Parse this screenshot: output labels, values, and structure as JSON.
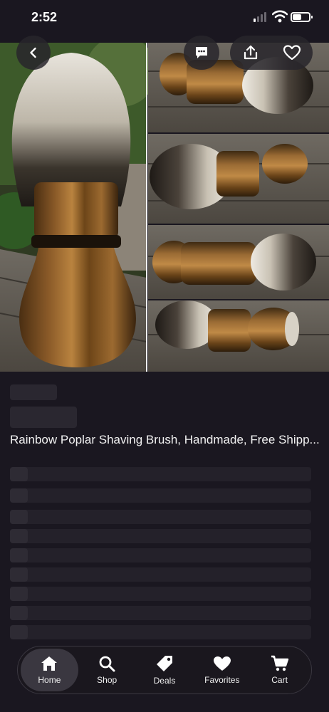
{
  "status_bar": {
    "time": "2:52",
    "cellular_bars_lit": 1,
    "battery_level": 0.55
  },
  "product": {
    "title": "Rainbow Poplar Shaving Brush, Handmade, Free Shipp..."
  },
  "tabs": [
    {
      "label": "Home",
      "icon": "home-icon",
      "active": true
    },
    {
      "label": "Shop",
      "icon": "search-icon",
      "active": false
    },
    {
      "label": "Deals",
      "icon": "tag-icon",
      "active": false
    },
    {
      "label": "Favorites",
      "icon": "heart-icon",
      "active": false
    },
    {
      "label": "Cart",
      "icon": "cart-icon",
      "active": false
    }
  ],
  "colors": {
    "background": "#1a1720",
    "skeleton": "#2a2730",
    "tab_active": "#3a3740"
  }
}
